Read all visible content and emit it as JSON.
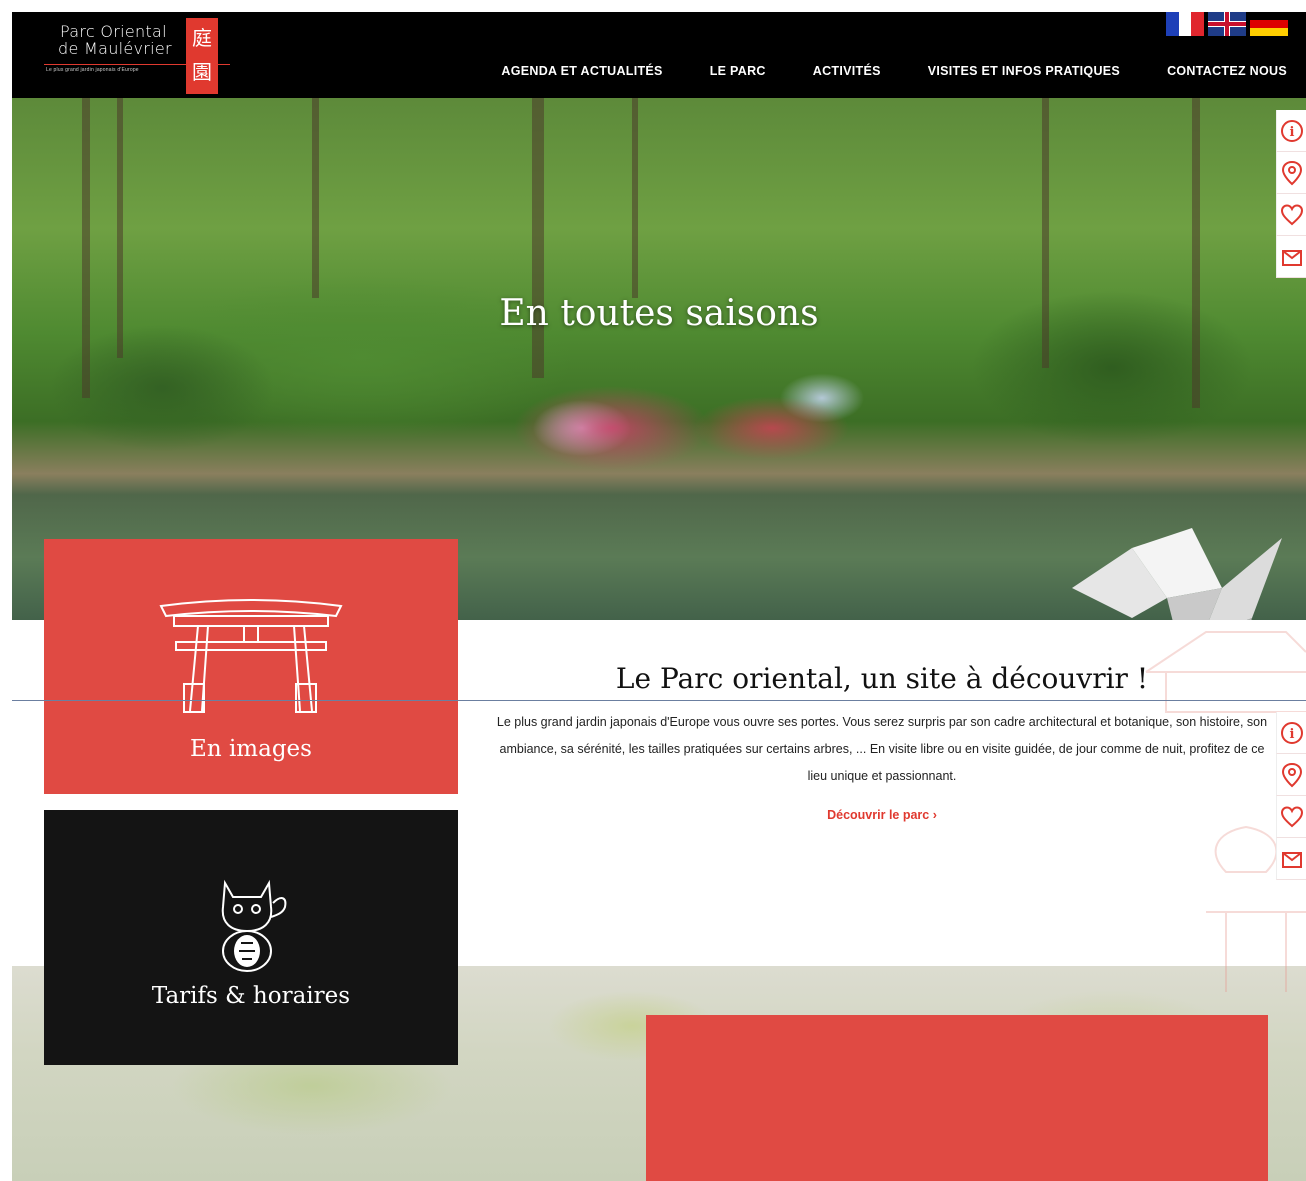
{
  "logo": {
    "line1": "Parc Oriental",
    "line2": "de Maulévrier",
    "tagline": "Le plus grand jardin japonais d'Europe",
    "kanji1": "庭",
    "kanji2": "園"
  },
  "languages": [
    "fr-flag",
    "uk-flag",
    "de-flag"
  ],
  "nav": [
    {
      "label": "AGENDA ET ACTUALITÉS"
    },
    {
      "label": "LE PARC"
    },
    {
      "label": "ACTIVITÉS"
    },
    {
      "label": "VISITES ET INFOS PRATIQUES"
    },
    {
      "label": "CONTACTEZ NOUS"
    }
  ],
  "hero": {
    "title": "En toutes saisons"
  },
  "side_icons": [
    "info-icon",
    "map-pin-icon",
    "heart-icon",
    "ticket-icon"
  ],
  "tiles": {
    "images": "En images",
    "tarifs": "Tarifs & horaires"
  },
  "intro": {
    "title": "Le Parc oriental, un site à découvrir !",
    "text": "Le plus grand jardin japonais d'Europe vous ouvre ses portes. Vous serez surpris par son cadre architectural et botanique, son histoire, son ambiance, sa sérénité, les tailles pratiquées sur certains arbres, ... En visite libre ou en visite guidée, de jour comme de nuit, profitez de ce lieu unique et passionnant.",
    "link": "Découvrir le parc ›"
  },
  "colors": {
    "accent": "#e04a43",
    "header": "#000000",
    "tile_dark": "#141414"
  }
}
